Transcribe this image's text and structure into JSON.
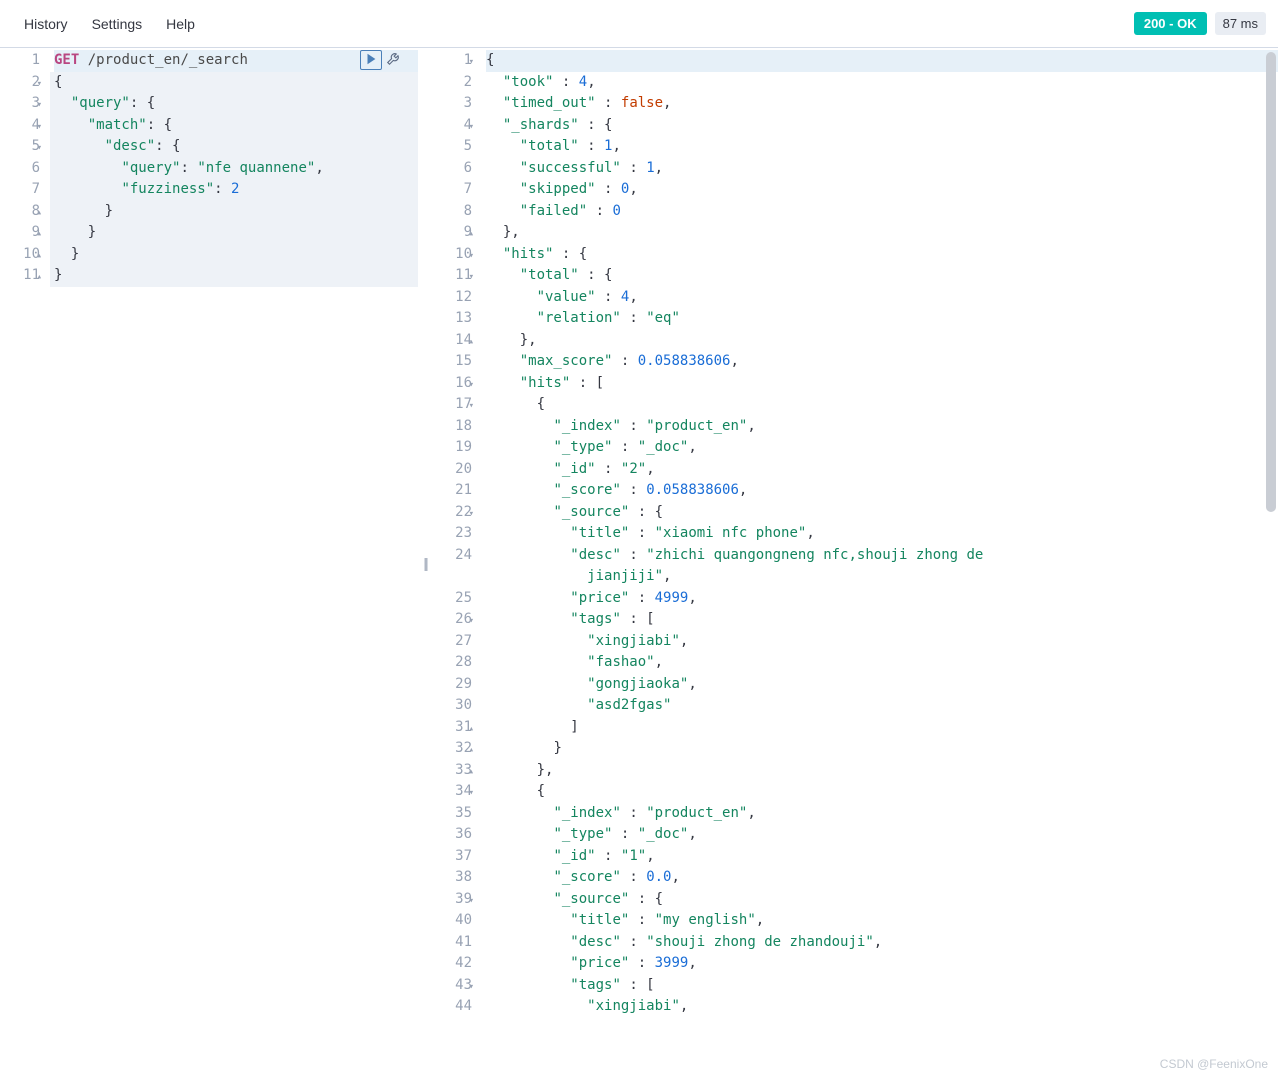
{
  "toolbar": {
    "history": "History",
    "settings": "Settings",
    "help": "Help"
  },
  "status": {
    "code": "200 - OK",
    "time": "87 ms"
  },
  "watermark": "CSDN @FeenixOne",
  "left": {
    "lines": [
      {
        "n": 1,
        "fold": "",
        "html": "<span class='method'>GET</span> <span class='path'>/product_en/_search</span>",
        "cur": true
      },
      {
        "n": 2,
        "fold": "▾",
        "html": "<span class='p'>{</span>"
      },
      {
        "n": 3,
        "fold": "▾",
        "html": "  <span class='key'>\"query\"</span><span class='p'>: {</span>"
      },
      {
        "n": 4,
        "fold": "▾",
        "html": "    <span class='key'>\"match\"</span><span class='p'>: {</span>"
      },
      {
        "n": 5,
        "fold": "▾",
        "html": "      <span class='key'>\"desc\"</span><span class='p'>: {</span>"
      },
      {
        "n": 6,
        "fold": "",
        "html": "        <span class='key'>\"query\"</span><span class='p'>: </span><span class='str'>\"nfe quannene\"</span><span class='p'>,</span>"
      },
      {
        "n": 7,
        "fold": "",
        "html": "        <span class='key'>\"fuzziness\"</span><span class='p'>: </span><span class='num'>2</span>"
      },
      {
        "n": 8,
        "fold": "▴",
        "html": "      <span class='p'>}</span>"
      },
      {
        "n": 9,
        "fold": "▴",
        "html": "    <span class='p'>}</span>"
      },
      {
        "n": 10,
        "fold": "▴",
        "html": "  <span class='p'>}</span>"
      },
      {
        "n": 11,
        "fold": "▴",
        "html": "<span class='p'>}</span>"
      }
    ]
  },
  "right": {
    "lines": [
      {
        "n": 1,
        "fold": "▾",
        "html": "<span class='p'>{</span>",
        "cur": true
      },
      {
        "n": 2,
        "fold": "",
        "html": "  <span class='key'>\"took\"</span> <span class='p'>:</span> <span class='num'>4</span><span class='p'>,</span>"
      },
      {
        "n": 3,
        "fold": "",
        "html": "  <span class='key'>\"timed_out\"</span> <span class='p'>:</span> <span class='bool'>false</span><span class='p'>,</span>"
      },
      {
        "n": 4,
        "fold": "▾",
        "html": "  <span class='key'>\"_shards\"</span> <span class='p'>: {</span>"
      },
      {
        "n": 5,
        "fold": "",
        "html": "    <span class='key'>\"total\"</span> <span class='p'>:</span> <span class='num'>1</span><span class='p'>,</span>"
      },
      {
        "n": 6,
        "fold": "",
        "html": "    <span class='key'>\"successful\"</span> <span class='p'>:</span> <span class='num'>1</span><span class='p'>,</span>"
      },
      {
        "n": 7,
        "fold": "",
        "html": "    <span class='key'>\"skipped\"</span> <span class='p'>:</span> <span class='num'>0</span><span class='p'>,</span>"
      },
      {
        "n": 8,
        "fold": "",
        "html": "    <span class='key'>\"failed\"</span> <span class='p'>:</span> <span class='num'>0</span>"
      },
      {
        "n": 9,
        "fold": "▴",
        "html": "  <span class='p'>},</span>"
      },
      {
        "n": 10,
        "fold": "▾",
        "html": "  <span class='key'>\"hits\"</span> <span class='p'>: {</span>"
      },
      {
        "n": 11,
        "fold": "▾",
        "html": "    <span class='key'>\"total\"</span> <span class='p'>: {</span>"
      },
      {
        "n": 12,
        "fold": "",
        "html": "      <span class='key'>\"value\"</span> <span class='p'>:</span> <span class='num'>4</span><span class='p'>,</span>"
      },
      {
        "n": 13,
        "fold": "",
        "html": "      <span class='key'>\"relation\"</span> <span class='p'>:</span> <span class='str'>\"eq\"</span>"
      },
      {
        "n": 14,
        "fold": "▴",
        "html": "    <span class='p'>},</span>"
      },
      {
        "n": 15,
        "fold": "",
        "html": "    <span class='key'>\"max_score\"</span> <span class='p'>:</span> <span class='num'>0.058838606</span><span class='p'>,</span>"
      },
      {
        "n": 16,
        "fold": "▾",
        "html": "    <span class='key'>\"hits\"</span> <span class='p'>: [</span>"
      },
      {
        "n": 17,
        "fold": "▾",
        "html": "      <span class='p'>{</span>"
      },
      {
        "n": 18,
        "fold": "",
        "html": "        <span class='key'>\"_index\"</span> <span class='p'>:</span> <span class='str'>\"product_en\"</span><span class='p'>,</span>"
      },
      {
        "n": 19,
        "fold": "",
        "html": "        <span class='key'>\"_type\"</span> <span class='p'>:</span> <span class='str'>\"_doc\"</span><span class='p'>,</span>"
      },
      {
        "n": 20,
        "fold": "",
        "html": "        <span class='key'>\"_id\"</span> <span class='p'>:</span> <span class='str'>\"2\"</span><span class='p'>,</span>"
      },
      {
        "n": 21,
        "fold": "",
        "html": "        <span class='key'>\"_score\"</span> <span class='p'>:</span> <span class='num'>0.058838606</span><span class='p'>,</span>"
      },
      {
        "n": 22,
        "fold": "▾",
        "html": "        <span class='key'>\"_source\"</span> <span class='p'>: {</span>"
      },
      {
        "n": 23,
        "fold": "",
        "html": "          <span class='key'>\"title\"</span> <span class='p'>:</span> <span class='str'>\"xiaomi nfc phone\"</span><span class='p'>,</span>"
      },
      {
        "n": 24,
        "fold": "",
        "html": "          <span class='key'>\"desc\"</span> <span class='p'>:</span> <span class='str'>\"zhichi quangongneng nfc,shouji zhong de\n            jianjiji\"</span><span class='p'>,</span>",
        "tall": true
      },
      {
        "n": 25,
        "fold": "",
        "html": "          <span class='key'>\"price\"</span> <span class='p'>:</span> <span class='num'>4999</span><span class='p'>,</span>"
      },
      {
        "n": 26,
        "fold": "▾",
        "html": "          <span class='key'>\"tags\"</span> <span class='p'>: [</span>"
      },
      {
        "n": 27,
        "fold": "",
        "html": "            <span class='str'>\"xingjiabi\"</span><span class='p'>,</span>"
      },
      {
        "n": 28,
        "fold": "",
        "html": "            <span class='str'>\"fashao\"</span><span class='p'>,</span>"
      },
      {
        "n": 29,
        "fold": "",
        "html": "            <span class='str'>\"gongjiaoka\"</span><span class='p'>,</span>"
      },
      {
        "n": 30,
        "fold": "",
        "html": "            <span class='str'>\"asd2fgas\"</span>"
      },
      {
        "n": 31,
        "fold": "▴",
        "html": "          <span class='p'>]</span>"
      },
      {
        "n": 32,
        "fold": "▴",
        "html": "        <span class='p'>}</span>"
      },
      {
        "n": 33,
        "fold": "▴",
        "html": "      <span class='p'>},</span>"
      },
      {
        "n": 34,
        "fold": "▾",
        "html": "      <span class='p'>{</span>"
      },
      {
        "n": 35,
        "fold": "",
        "html": "        <span class='key'>\"_index\"</span> <span class='p'>:</span> <span class='str'>\"product_en\"</span><span class='p'>,</span>"
      },
      {
        "n": 36,
        "fold": "",
        "html": "        <span class='key'>\"_type\"</span> <span class='p'>:</span> <span class='str'>\"_doc\"</span><span class='p'>,</span>"
      },
      {
        "n": 37,
        "fold": "",
        "html": "        <span class='key'>\"_id\"</span> <span class='p'>:</span> <span class='str'>\"1\"</span><span class='p'>,</span>"
      },
      {
        "n": 38,
        "fold": "",
        "html": "        <span class='key'>\"_score\"</span> <span class='p'>:</span> <span class='num'>0.0</span><span class='p'>,</span>"
      },
      {
        "n": 39,
        "fold": "▾",
        "html": "        <span class='key'>\"_source\"</span> <span class='p'>: {</span>"
      },
      {
        "n": 40,
        "fold": "",
        "html": "          <span class='key'>\"title\"</span> <span class='p'>:</span> <span class='str'>\"my english\"</span><span class='p'>,</span>"
      },
      {
        "n": 41,
        "fold": "",
        "html": "          <span class='key'>\"desc\"</span> <span class='p'>:</span> <span class='str'>\"shouji zhong de zhandouji\"</span><span class='p'>,</span>"
      },
      {
        "n": 42,
        "fold": "",
        "html": "          <span class='key'>\"price\"</span> <span class='p'>:</span> <span class='num'>3999</span><span class='p'>,</span>"
      },
      {
        "n": 43,
        "fold": "▾",
        "html": "          <span class='key'>\"tags\"</span> <span class='p'>: [</span>"
      },
      {
        "n": 44,
        "fold": "",
        "html": "            <span class='str'>\"xingjiabi\"</span><span class='p'>,</span>"
      }
    ]
  }
}
